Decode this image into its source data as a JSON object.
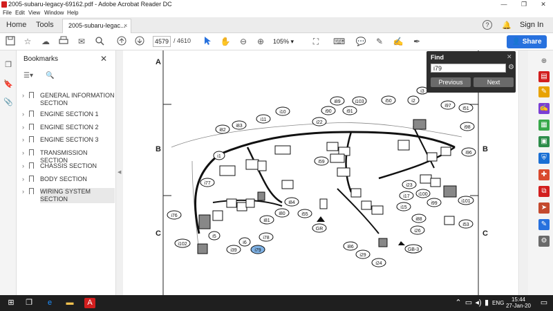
{
  "window": {
    "title": "2005-subaru-legacy-69162.pdf - Adobe Acrobat Reader DC",
    "controls": [
      "—",
      "❐",
      "✕"
    ]
  },
  "menu": [
    "File",
    "Edit",
    "View",
    "Window",
    "Help"
  ],
  "tabs": {
    "home": "Home",
    "tools": "Tools",
    "document": "2005-subaru-legac...",
    "close": "×"
  },
  "header_right": {
    "help": "?",
    "sign_in": "Sign In"
  },
  "toolbar": {
    "page_current": "4579",
    "page_total": "/ 4610",
    "zoom": "105%",
    "share": "Share"
  },
  "bookmarks": {
    "title": "Bookmarks",
    "items": [
      {
        "label": "GENERAL INFORMATION SECTION"
      },
      {
        "label": "ENGINE SECTION 1"
      },
      {
        "label": "ENGINE SECTION 2"
      },
      {
        "label": "ENGINE SECTION 3"
      },
      {
        "label": "TRANSMISSION SECTION"
      },
      {
        "label": "CHASSIS SECTION"
      },
      {
        "label": "BODY SECTION"
      },
      {
        "label": "WIRING SYSTEM SECTION"
      }
    ]
  },
  "find": {
    "title": "Find",
    "query": "i79",
    "previous": "Previous",
    "next": "Next"
  },
  "diagram": {
    "row_labels": [
      "A",
      "B",
      "C"
    ],
    "connectors": [
      "i3",
      "i89",
      "i103",
      "i50",
      "i2",
      "i97",
      "i51",
      "i10",
      "i90",
      "i91",
      "i11",
      "i22",
      "i83",
      "i98",
      "i82",
      "i96",
      "i59",
      "i1",
      "i23",
      "i77",
      "i17",
      "i100",
      "i99",
      "i101",
      "i84",
      "i15",
      "i76",
      "i80",
      "i55",
      "i88",
      "i53",
      "i81",
      "i26",
      "i5",
      "i102",
      "i6",
      "i78",
      "i86",
      "i39",
      "i79",
      "i29",
      "i24"
    ],
    "markers": [
      "GR",
      "GB-3"
    ]
  },
  "taskbar": {
    "lang": "ENG",
    "time": "15:44",
    "date": "27-Jan-20"
  },
  "colors": {
    "accent": "#2771de",
    "find_bg": "#2e2e2e",
    "acrobat_red": "#d21e1e",
    "highlight": "#7fb2e5"
  }
}
